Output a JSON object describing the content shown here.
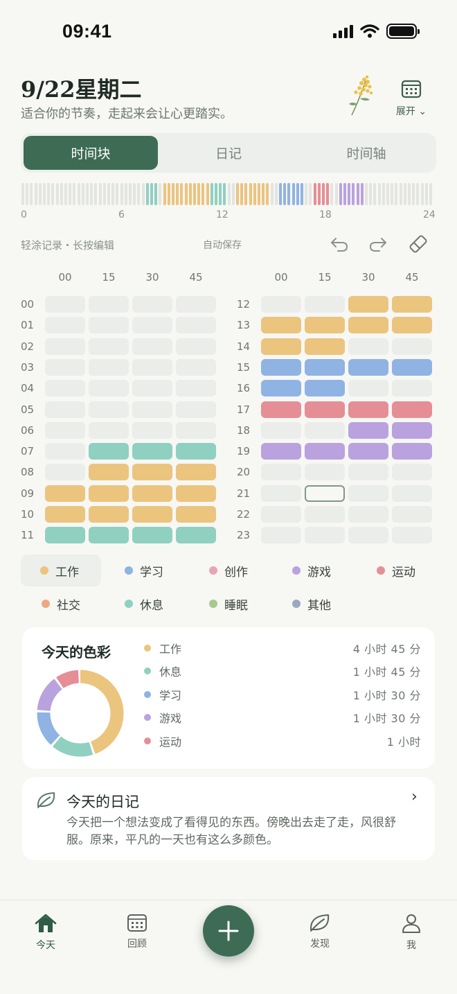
{
  "status_bar": {
    "time": "09:41"
  },
  "header": {
    "date": "9/22星期二",
    "subtitle": "适合你的节奏，走起来会让心更踏实。",
    "expand_label": "展开"
  },
  "tabs": [
    {
      "label": "时间块",
      "active": true
    },
    {
      "label": "日记",
      "active": false
    },
    {
      "label": "时间轴",
      "active": false
    }
  ],
  "timeline": {
    "axis_labels": [
      "0",
      "6",
      "12",
      "18",
      "24"
    ]
  },
  "toolbar": {
    "hint": "轻涂记录・长按编辑",
    "autosave": "自动保存"
  },
  "grid": {
    "column_headers": [
      "00",
      "15",
      "30",
      "45"
    ],
    "left_hours": [
      "00",
      "01",
      "02",
      "03",
      "04",
      "05",
      "06",
      "07",
      "08",
      "09",
      "10",
      "11"
    ],
    "right_hours": [
      "12",
      "13",
      "14",
      "15",
      "16",
      "17",
      "18",
      "19",
      "20",
      "21",
      "22",
      "23"
    ],
    "blocks": [
      "----",
      "----",
      "----",
      "----",
      "----",
      "----",
      "----",
      "-RRR",
      "-WWW",
      "WWWW",
      "WWWW",
      "RRRR",
      "--WW",
      "WWWW",
      "WW--",
      "SSSS",
      "SS--",
      "EEEE",
      "--GG",
      "GGGG",
      "----",
      "----",
      "----",
      "----"
    ],
    "selected_slot": "21:15"
  },
  "categories": {
    "W": {
      "label": "工作",
      "color": "#ebc47e"
    },
    "S": {
      "label": "学习",
      "color": "#8fb3e2"
    },
    "C": {
      "label": "创作",
      "color": "#e8a3b6"
    },
    "G": {
      "label": "游戏",
      "color": "#b9a2de"
    },
    "E": {
      "label": "运动",
      "color": "#e58e96"
    },
    "O": {
      "label": "社交",
      "color": "#eda97d"
    },
    "R": {
      "label": "休息",
      "color": "#8fd0c1"
    },
    "L": {
      "label": "睡眠",
      "color": "#a6c98e"
    },
    "T": {
      "label": "其他",
      "color": "#9aa9c0"
    }
  },
  "legend": [
    {
      "key": "W",
      "label": "工作",
      "color": "#ebc47e",
      "active": true
    },
    {
      "key": "S",
      "label": "学习",
      "color": "#8fb3e2"
    },
    {
      "key": "C",
      "label": "创作",
      "color": "#e8a3b6"
    },
    {
      "key": "G",
      "label": "游戏",
      "color": "#b9a2de"
    },
    {
      "key": "E",
      "label": "运动",
      "color": "#e58e96"
    },
    {
      "key": "O",
      "label": "社交",
      "color": "#eda97d"
    },
    {
      "key": "R",
      "label": "休息",
      "color": "#8fd0c1"
    },
    {
      "key": "L",
      "label": "睡眠",
      "color": "#a6c98e"
    },
    {
      "key": "T",
      "label": "其他",
      "color": "#9aa9c0"
    }
  ],
  "colors_card": {
    "title": "今天的色彩",
    "stats": [
      {
        "label": "工作",
        "value": "4 小时 45 分",
        "minutes": 285,
        "color": "#ebc47e"
      },
      {
        "label": "休息",
        "value": "1 小时 45 分",
        "minutes": 105,
        "color": "#8fd0c1"
      },
      {
        "label": "学习",
        "value": "1 小时 30 分",
        "minutes": 90,
        "color": "#8fb3e2"
      },
      {
        "label": "游戏",
        "value": "1 小时 30 分",
        "minutes": 90,
        "color": "#b9a2de"
      },
      {
        "label": "运动",
        "value": "1 小时",
        "minutes": 60,
        "color": "#e58e96"
      }
    ]
  },
  "diary_card": {
    "title": "今天的日记",
    "text": "今天把一个想法变成了看得见的东西。傍晚出去走了走，风很舒服。原来，平凡的一天也有这么多颜色。"
  },
  "bottom_nav": [
    {
      "label": "今天",
      "icon": "home-icon",
      "active": true
    },
    {
      "label": "回顾",
      "icon": "calendar-icon"
    },
    {
      "label": "发现",
      "icon": "leaf-icon"
    },
    {
      "label": "我",
      "icon": "person-icon"
    }
  ]
}
